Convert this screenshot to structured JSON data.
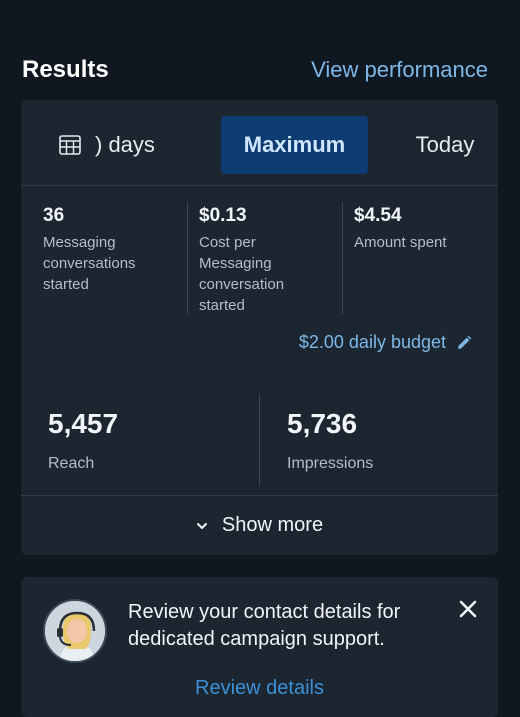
{
  "header": {
    "title": "Results",
    "view_link": "View performance"
  },
  "tabs": {
    "range": ") days",
    "active": "Maximum",
    "today": "Today"
  },
  "metrics": [
    {
      "value": "36",
      "label": "Messaging conversations started"
    },
    {
      "value": "$0.13",
      "label": "Cost per Messaging conversation started"
    },
    {
      "value": "$4.54",
      "label": "Amount spent"
    }
  ],
  "budget": {
    "label": "$2.00 daily budget"
  },
  "stats": [
    {
      "value": "5,457",
      "label": "Reach"
    },
    {
      "value": "5,736",
      "label": "Impressions"
    }
  ],
  "show_more": "Show more",
  "notice": {
    "text": "Review your contact details for dedicated campaign support.",
    "action": "Review details"
  },
  "icons": {
    "calendar": "calendar-grid-icon",
    "pencil": "pencil-icon",
    "chevron": "chevron-down-icon",
    "close": "close-icon"
  },
  "colors": {
    "accent": "#7fb8e6",
    "active_tab_bg": "#0e3b72",
    "link": "#3d8fd6"
  }
}
